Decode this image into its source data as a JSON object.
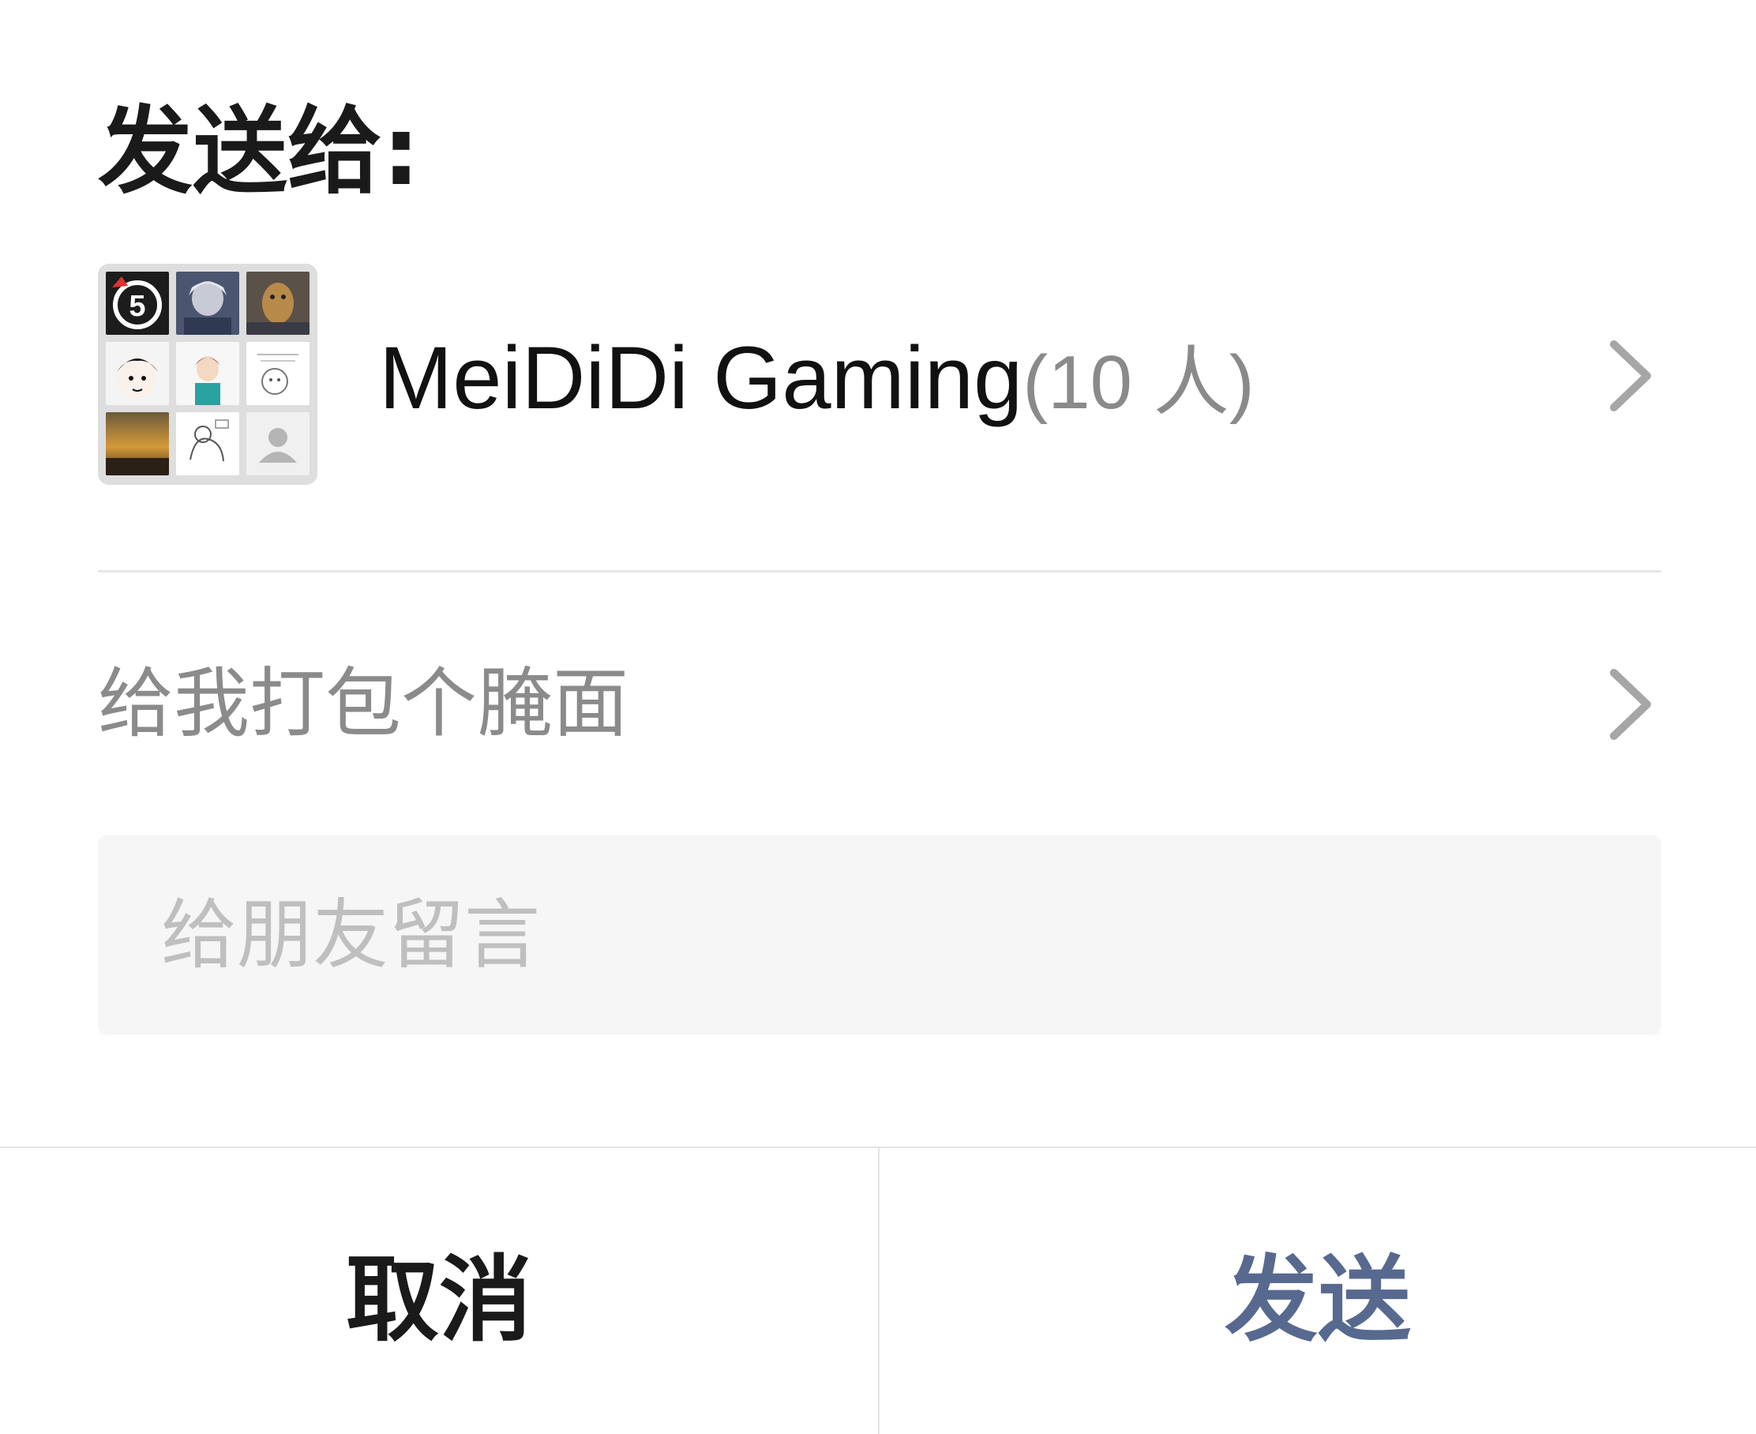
{
  "dialog": {
    "title": "发送给:",
    "recipient": {
      "name": "MeiDiDi Gaming",
      "member_count": "(10 人)",
      "avatar_tiles": [
        "5-badge-icon",
        "anime-portrait",
        "dog-photo",
        "cartoon-face",
        "anime-boy",
        "meme-sticker",
        "sunset-photo",
        "sketch-sticker",
        "default-avatar-icon"
      ]
    },
    "link_title": "给我打包个腌面",
    "message_placeholder": "给朋友留言",
    "message_value": "",
    "cancel_label": "取消",
    "send_label": "发送"
  },
  "colors": {
    "send_accent": "#57698f",
    "secondary_text": "#8b8b8b",
    "placeholder": "#bfbfbf",
    "input_background": "#f6f6f6"
  }
}
